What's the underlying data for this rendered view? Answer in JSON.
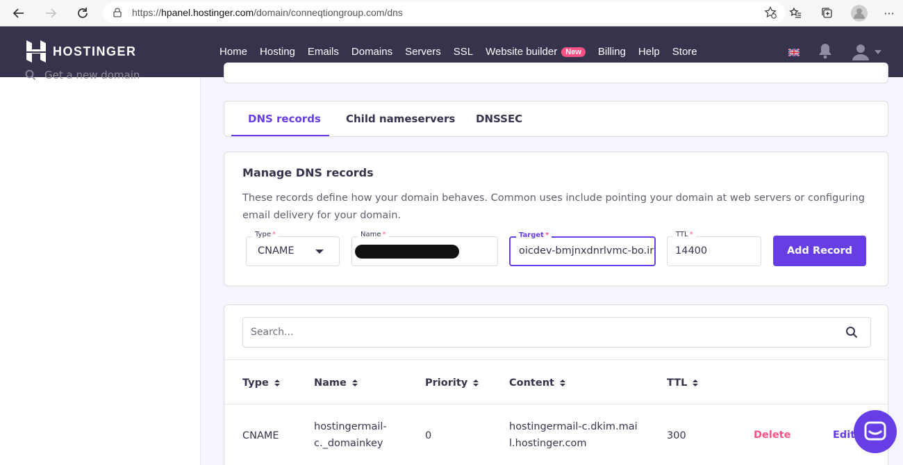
{
  "browser": {
    "url_prefix": "https://",
    "url_host": "hpanel.hostinger.com",
    "url_path": "/domain/conneqtiongroup.com/dns",
    "more_label": "···"
  },
  "header": {
    "logo_text": "HOSTINGER",
    "nav": [
      "Home",
      "Hosting",
      "Emails",
      "Domains",
      "Servers",
      "SSL",
      "Website builder",
      "Billing",
      "Help",
      "Store"
    ],
    "new_badge": "New"
  },
  "sidebar": {
    "item_label": "Get a new domain"
  },
  "tabs": [
    "DNS records",
    "Child nameservers",
    "DNSSEC"
  ],
  "manage": {
    "title": "Manage DNS records",
    "description": "These records define how your domain behaves. Common uses include pointing your domain at web servers or configuring email delivery for your domain.",
    "type_label": "Type",
    "type_value": "CNAME",
    "name_label": "Name",
    "target_label": "Target",
    "target_value": "oicdev-bmjnxdnrlvmc-bo.ir",
    "ttl_label": "TTL",
    "ttl_value": "14400",
    "required_mark": "*",
    "add_button": "Add Record"
  },
  "records": {
    "search_placeholder": "Search...",
    "columns": [
      "Type",
      "Name",
      "Priority",
      "Content",
      "TTL"
    ],
    "rows": [
      {
        "type": "CNAME",
        "name_line1": "hostingermail-",
        "name_line2": "c._domainkey",
        "priority": "0",
        "content_line1": "hostingermail-c.dkim.mai",
        "content_line2": "l.hostinger.com",
        "ttl": "300",
        "delete_label": "Delete",
        "edit_label": "Edit"
      }
    ]
  },
  "colors": {
    "brand_dark": "#36344d",
    "accent": "#673de6",
    "danger": "#fc5185"
  }
}
